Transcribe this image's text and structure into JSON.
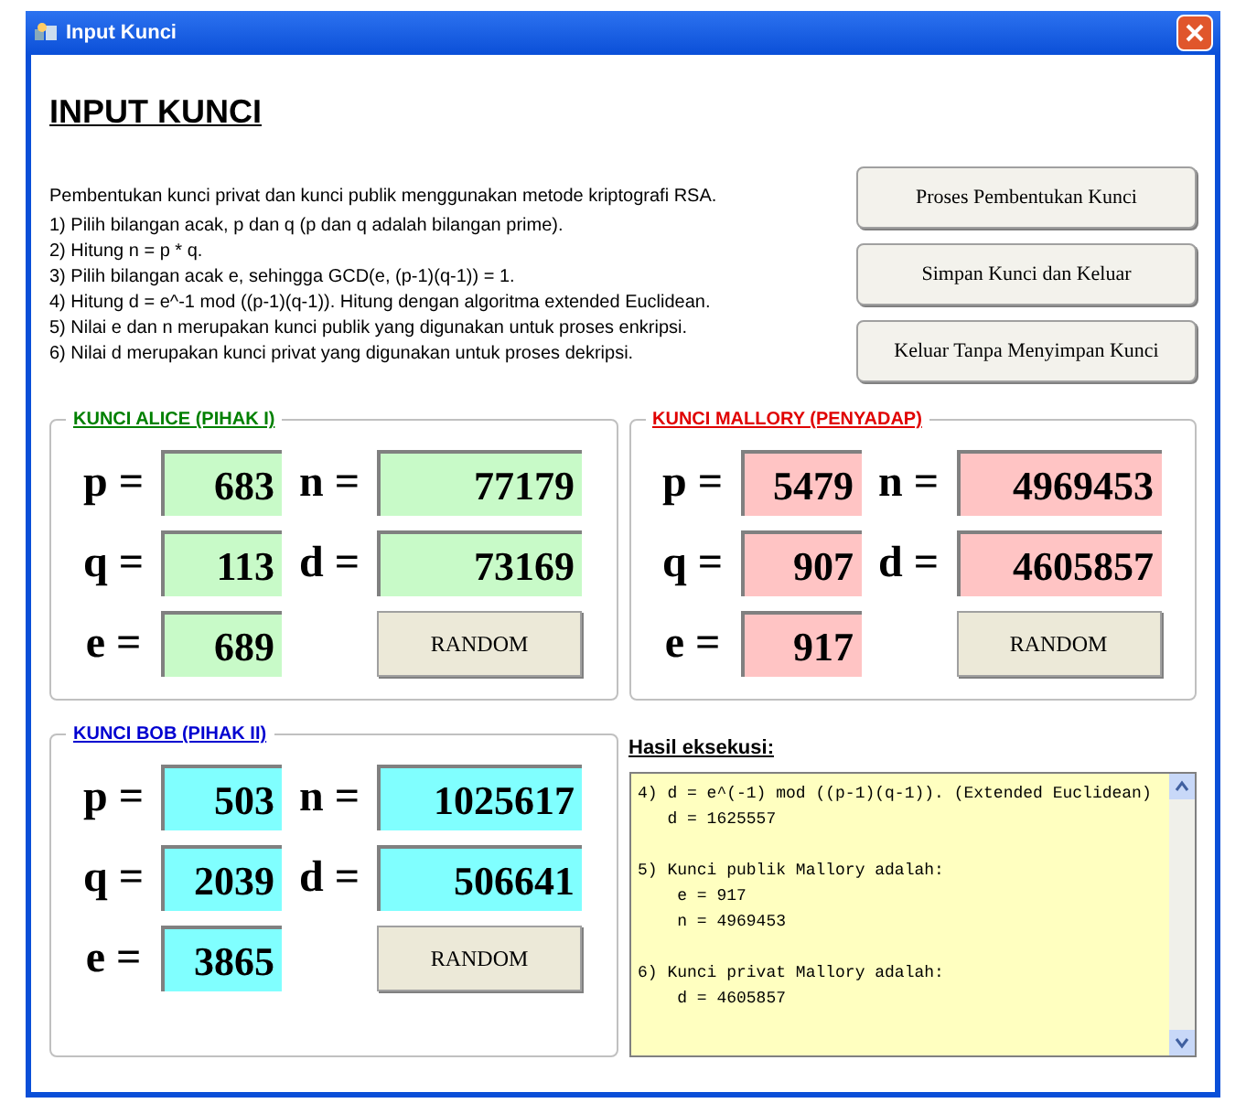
{
  "window": {
    "title": "Input Kunci"
  },
  "heading": "INPUT KUNCI",
  "description": {
    "intro": "Pembentukan kunci privat dan kunci publik menggunakan metode kriptografi RSA.",
    "steps": [
      "1) Pilih bilangan acak, p dan q (p dan q adalah bilangan prime).",
      "2) Hitung n = p * q.",
      "3) Pilih bilangan acak e, sehingga GCD(e, (p-1)(q-1)) = 1.",
      "4) Hitung d = e^-1 mod ((p-1)(q-1)). Hitung dengan algoritma extended Euclidean.",
      "5) Nilai e dan n merupakan kunci publik yang digunakan untuk proses enkripsi.",
      "6) Nilai d merupakan kunci privat yang digunakan untuk proses dekripsi."
    ]
  },
  "actions": [
    "Proses Pembentukan Kunci",
    "Simpan Kunci dan Keluar",
    "Keluar Tanpa Menyimpan Kunci"
  ],
  "groups": [
    {
      "title": "KUNCI ALICE (PIHAK I)",
      "kind": "sender",
      "fields": [
        {
          "label": "p =",
          "value": "683"
        },
        {
          "label": "n =",
          "value": "77179"
        },
        {
          "label": "q =",
          "value": "113"
        },
        {
          "label": "d =",
          "value": "73169"
        },
        {
          "label": "e =",
          "value": "689"
        }
      ],
      "button": "RANDOM"
    },
    {
      "title": "KUNCI MALLORY (PENYADAP)",
      "kind": "eavesdropper",
      "fields": [
        {
          "label": "p =",
          "value": "5479"
        },
        {
          "label": "n =",
          "value": "4969453"
        },
        {
          "label": "q =",
          "value": "907"
        },
        {
          "label": "d =",
          "value": "4605857"
        },
        {
          "label": "e =",
          "value": "917"
        }
      ],
      "button": "RANDOM"
    },
    {
      "title": "KUNCI BOB (PIHAK II)",
      "kind": "receiver",
      "fields": [
        {
          "label": "p =",
          "value": "503"
        },
        {
          "label": "n =",
          "value": "1025617"
        },
        {
          "label": "q =",
          "value": "2039"
        },
        {
          "label": "d =",
          "value": "506641"
        },
        {
          "label": "e =",
          "value": "3865"
        }
      ],
      "button": "RANDOM"
    }
  ],
  "result": {
    "title": "Hasil eksekusi:",
    "blocks": [
      [
        "4) d = e^(-1) mod ((p-1)(q-1)). (Extended Euclidean)",
        "   d = 1625557"
      ],
      [
        "5) Kunci publik Mallory adalah:",
        "    e = 917",
        "    n = 4969453"
      ],
      [
        "6) Kunci privat Mallory adalah:",
        "    d = 4605857"
      ]
    ]
  }
}
